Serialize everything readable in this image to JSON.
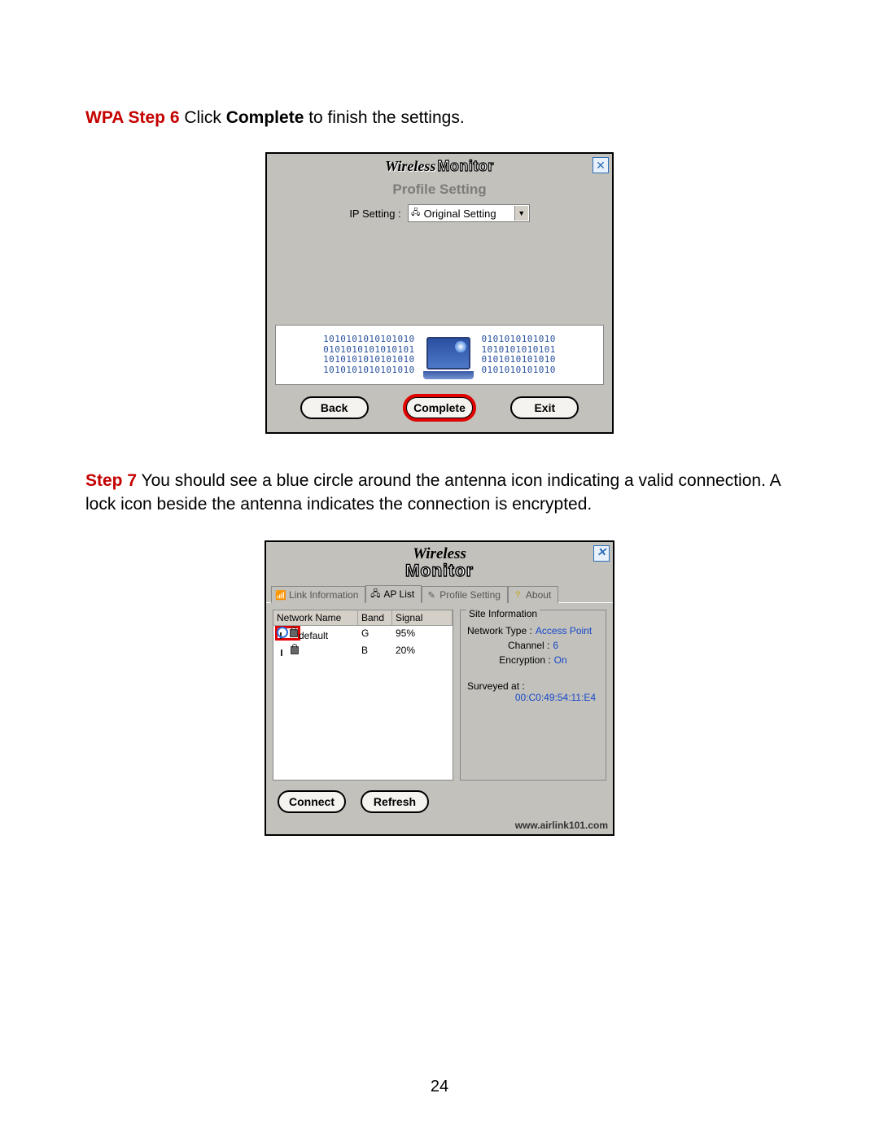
{
  "page_number": "24",
  "step6": {
    "prefix": "WPA Step 6",
    "mid1": " Click ",
    "bold": "Complete",
    "mid2": " to finish the settings."
  },
  "step7": {
    "prefix": "Step 7",
    "text": " You should see a blue circle around the antenna icon indicating a valid connection. A lock icon beside the antenna indicates the connection is encrypted."
  },
  "shot1": {
    "title_a": "Wireless",
    "title_b": "Monitor",
    "close": "✕",
    "subheader": "Profile Setting",
    "ip_label": "IP Setting :",
    "ip_value": "Original Setting",
    "binary_left": "1010101010101010\n0101010101010101\n1010101010101010\n1010101010101010",
    "binary_right": "0101010101010\n1010101010101\n0101010101010\n0101010101010",
    "btn_back": "Back",
    "btn_complete": "Complete",
    "btn_exit": "Exit"
  },
  "shot2": {
    "title_a": "Wireless",
    "title_b": "Monitor",
    "close": "✕",
    "tabs": {
      "link": "Link Information",
      "ap": "AP List",
      "profile": "Profile Setting",
      "about": "About"
    },
    "cols": {
      "name": "Network Name",
      "band": "Band",
      "signal": "Signal"
    },
    "rows": [
      {
        "name": "default",
        "band": "G",
        "signal": "95%"
      },
      {
        "name": "",
        "band": "B",
        "signal": "20%"
      }
    ],
    "info": {
      "legend": "Site Information",
      "nt_k": "Network Type :",
      "nt_v": "Access Point",
      "ch_k": "Channel :",
      "ch_v": "6",
      "en_k": "Encryption :",
      "en_v": "On",
      "sv_k": "Surveyed at :",
      "mac": "00:C0:49:54:11:E4"
    },
    "btn_connect": "Connect",
    "btn_refresh": "Refresh",
    "footer": "www.airlink101.com"
  }
}
